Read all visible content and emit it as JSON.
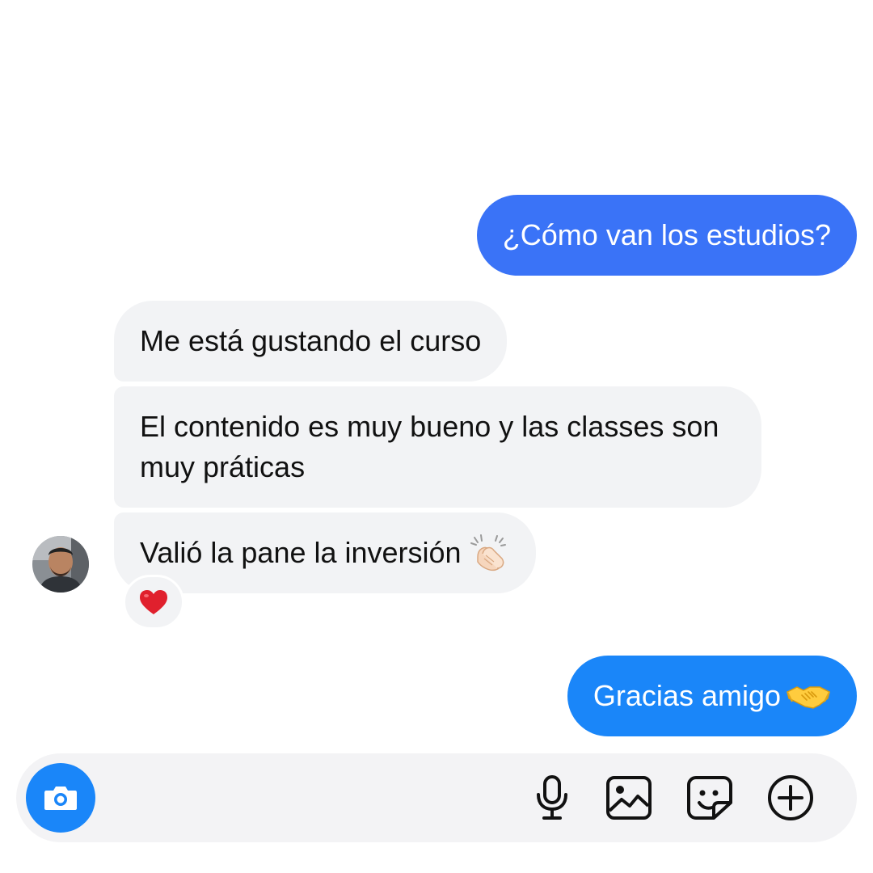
{
  "messages": [
    {
      "direction": "outgoing",
      "text": "¿Cómo van los estudios?"
    },
    {
      "direction": "incoming",
      "text": "Me está gustando el curso"
    },
    {
      "direction": "incoming",
      "text": "El contenido es muy bueno y las classes son muy práticas"
    },
    {
      "direction": "incoming",
      "text": "Valió la pane la inversión",
      "emoji": "clapping-hands",
      "reaction": "heart"
    },
    {
      "direction": "outgoing",
      "text": "Gracias amigo",
      "emoji": "handshake"
    }
  ],
  "composer": {
    "buttons": [
      "camera-icon",
      "microphone-icon",
      "gallery-icon",
      "sticker-icon",
      "plus-icon"
    ]
  },
  "colors": {
    "outgoing_first": "#3a73f7",
    "outgoing_last": "#1a86f9",
    "incoming_bg": "#f2f3f5",
    "composer_bg": "#f3f3f5",
    "camera_button": "#1a86f9"
  }
}
